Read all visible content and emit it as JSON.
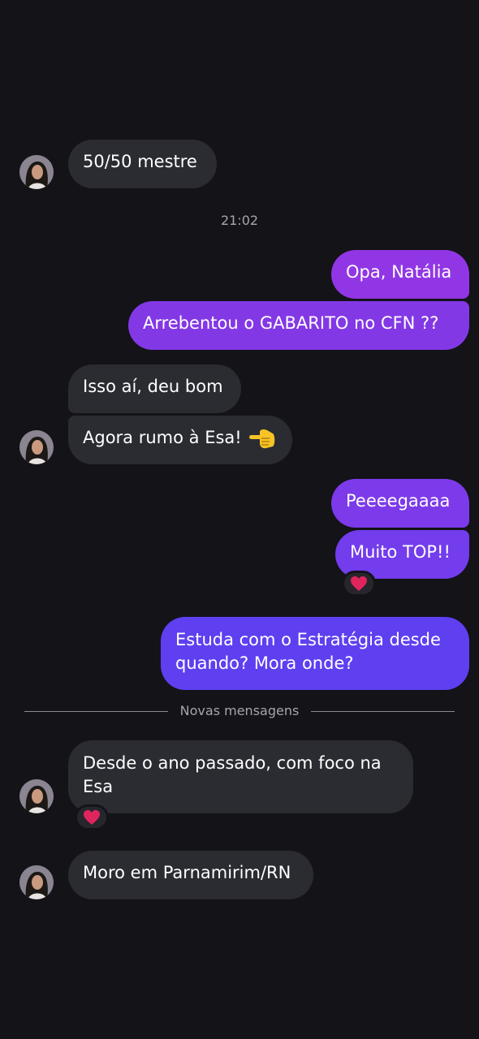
{
  "chat": {
    "timestamp": "21:02",
    "new_messages_label": "Novas mensagens",
    "colors": {
      "background": "#131318",
      "incoming_bubble": "#2b2c32",
      "outgoing_gradient_top": "#9b33e0",
      "outgoing_gradient_bottom": "#5a3ef0",
      "reaction": "#e0245e"
    },
    "messages": [
      {
        "id": "m1",
        "direction": "incoming",
        "text": "50/50 mestre"
      },
      {
        "id": "m2",
        "direction": "outgoing",
        "text": "Opa, Natália"
      },
      {
        "id": "m3",
        "direction": "outgoing",
        "text": "Arrebentou o GABARITO no CFN ??"
      },
      {
        "id": "m4",
        "direction": "incoming",
        "text": "Isso aí, deu bom"
      },
      {
        "id": "m5",
        "direction": "incoming",
        "text": "Agora rumo à Esa!",
        "emoji": "backhand-index-pointing-left"
      },
      {
        "id": "m6",
        "direction": "outgoing",
        "text": "Peeeegaaaa"
      },
      {
        "id": "m7",
        "direction": "outgoing",
        "text": "Muito TOP!!",
        "reaction": "heart-icon"
      },
      {
        "id": "m8",
        "direction": "outgoing",
        "line1": "Estuda com o Estratégia desde",
        "line2": "quando? Mora onde?"
      },
      {
        "id": "m9",
        "direction": "incoming",
        "line1": "Desde o ano passado, com foco na",
        "line2": "Esa",
        "reaction": "heart-icon"
      },
      {
        "id": "m10",
        "direction": "incoming",
        "text": "Moro em Parnamirim/RN"
      }
    ]
  }
}
